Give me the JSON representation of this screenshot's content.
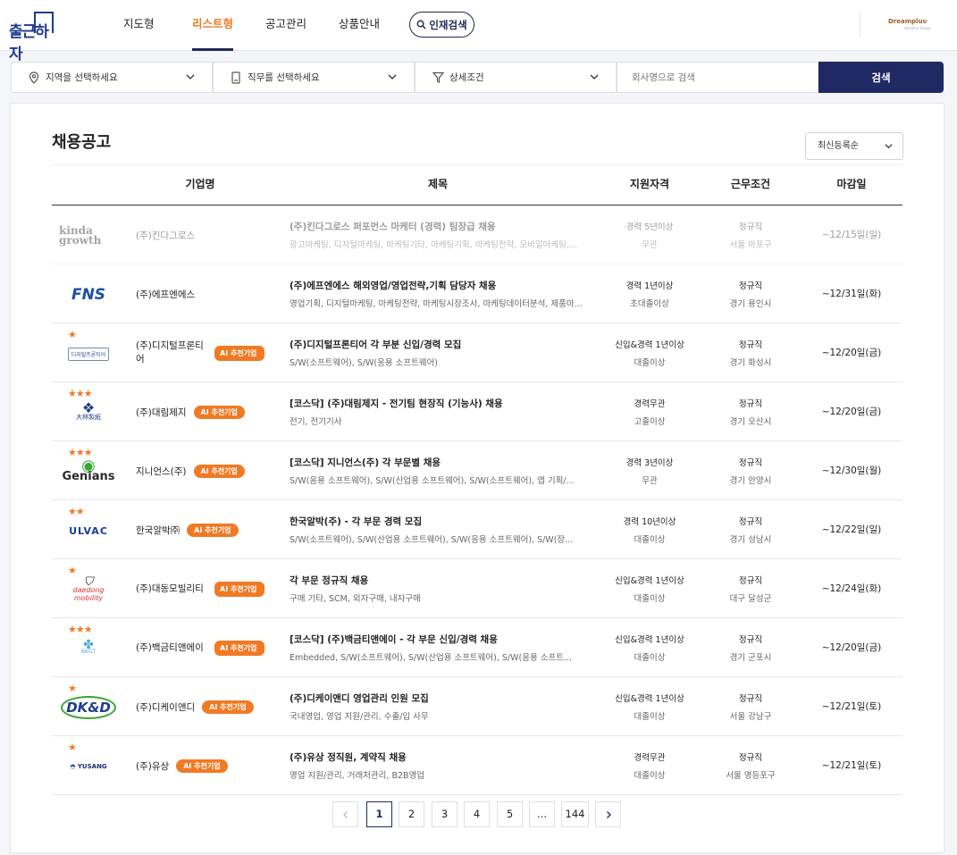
{
  "header": {
    "logo_text": "출근하자",
    "nav": [
      "지도형",
      "리스트형",
      "공고관리",
      "상품안내"
    ],
    "active_nav": "리스트형",
    "talent_search_label": "인재검색",
    "brand_text": "Dreamplus",
    "brand_sub": "Hanwha Group"
  },
  "search": {
    "region_placeholder": "지역을 선택하세요",
    "job_placeholder": "직무를 선택하세요",
    "detail_label": "상세조건",
    "company_placeholder": "회사명으로 검색",
    "search_button": "검색"
  },
  "main": {
    "title": "채용공고",
    "sort_selected": "최신등록순",
    "columns": [
      "기업명",
      "제목",
      "지원자격",
      "근무조건",
      "마감일"
    ],
    "ai_badge": "AI 추천기업"
  },
  "rows": [
    {
      "logo": "kinda growth",
      "stars": "",
      "company": "(주)킨다그로스",
      "ai": false,
      "dimmed": true,
      "title": "(주)킨다그로스 퍼포먼스 마케터 (경력) 팀장급 채용",
      "tags": "광고마케팅, 디지털마케팅, 마케팅기타, 마케팅기획, 마케팅전략, 모바일마케팅,...",
      "qual1": "경력 5년이상",
      "qual2": "무관",
      "work1": "정규직",
      "work2": "서울 마포구",
      "deadline": "~12/15일(일)"
    },
    {
      "logo": "FNS",
      "stars": "",
      "company": "(주)에프엔에스",
      "ai": false,
      "dimmed": false,
      "title": "(주)에프엔에스 해외영업/영업전략,기획 담당자 채용",
      "tags": "영업기획, 디지털마케팅, 마케팅전략, 마케팅시장조사, 마케팅데이터분석, 제품마...",
      "qual1": "경력 1년이상",
      "qual2": "초대졸이상",
      "work1": "정규직",
      "work2": "경기 용인시",
      "deadline": "~12/31일(화)"
    },
    {
      "logo": "디지털프론티어",
      "stars": "★",
      "company": "(주)디지털프론티어",
      "ai": true,
      "dimmed": false,
      "title": "(주)디지털프론티어 각 부분 신입/경력 모집",
      "tags": "S/W(소프트웨어), S/W(응용 소프트웨어)",
      "qual1": "신입&경력 1년이상",
      "qual2": "대졸이상",
      "work1": "정규직",
      "work2": "경기 화성시",
      "deadline": "~12/20일(금)"
    },
    {
      "logo": "大林製紙",
      "stars": "★★★",
      "company": "(주)대림제지",
      "ai": true,
      "dimmed": false,
      "title": "[코스닥] (주)대림제지 - 전기팀 현장직 (기능사) 채용",
      "tags": "전기, 전기기사",
      "qual1": "경력무관",
      "qual2": "고졸이상",
      "work1": "정규직",
      "work2": "경기 오산시",
      "deadline": "~12/20일(금)"
    },
    {
      "logo": "Genians",
      "stars": "★★★",
      "company": "지니언스(주)",
      "ai": true,
      "dimmed": false,
      "title": "[코스닥] 지니언스(주) 각 부문별 채용",
      "tags": "S/W(응용 소프트웨어), S/W(산업용 소프트웨어), S/W(소프트웨어), 앱 기획/...",
      "qual1": "경력 3년이상",
      "qual2": "무관",
      "work1": "정규직",
      "work2": "경기 안양시",
      "deadline": "~12/30일(월)"
    },
    {
      "logo": "ULVAC",
      "stars": "★★",
      "company": "한국알박㈜",
      "ai": true,
      "dimmed": false,
      "title": "한국알박(주) - 각 부문 경력 모집",
      "tags": "S/W(소프트웨어), S/W(산업용 소프트웨어), S/W(응용 소프트웨어), S/W(장...",
      "qual1": "경력 10년이상",
      "qual2": "대졸이상",
      "work1": "정규직",
      "work2": "경기 성남시",
      "deadline": "~12/22일(일)"
    },
    {
      "logo": "daedong mobility",
      "stars": "★",
      "company": "(주)대동모빌리티",
      "ai": true,
      "dimmed": false,
      "title": "각 부문 정규직 채용",
      "tags": "구매 기타, SCM, 외자구매, 내자구매",
      "qual1": "신입&경력 1년이상",
      "qual2": "대졸이상",
      "work1": "정규직",
      "work2": "대구 달성군",
      "deadline": "~12/24일(화)"
    },
    {
      "logo": "BKGT",
      "stars": "★★★",
      "company": "(주)백금티앤에이",
      "ai": true,
      "dimmed": false,
      "title": "[코스닥] (주)백금티앤에이 - 각 부문 신입/경력 채용",
      "tags": "Embedded, S/W(소프트웨어), S/W(산업용 소프트웨어), S/W(응용 소프트...",
      "qual1": "신입&경력 1년이상",
      "qual2": "대졸이상",
      "work1": "정규직",
      "work2": "경기 군포시",
      "deadline": "~12/20일(금)"
    },
    {
      "logo": "DK&D",
      "stars": "★",
      "company": "(주)디케이앤디",
      "ai": true,
      "dimmed": false,
      "title": "(주)디케이앤디 영업관리 인원 모집",
      "tags": "국내영업, 영업 지원/관리, 수출/입 사무",
      "qual1": "신입&경력 1년이상",
      "qual2": "대졸이상",
      "work1": "정규직",
      "work2": "서울 강남구",
      "deadline": "~12/21일(토)"
    },
    {
      "logo": "YUSANG",
      "stars": "★",
      "company": "(주)유상",
      "ai": true,
      "dimmed": false,
      "title": "(주)유상 정직원, 계약직 채용",
      "tags": "영업 지원/관리, 거래처관리, B2B영업",
      "qual1": "경력무관",
      "qual2": "대졸이상",
      "work1": "정규직",
      "work2": "서울 영등포구",
      "deadline": "~12/21일(토)"
    }
  ],
  "pagination": {
    "pages": [
      "1",
      "2",
      "3",
      "4",
      "5",
      "...",
      "144"
    ],
    "current": "1"
  },
  "colors": {
    "accent": "#f07a24",
    "primary": "#1f2a64"
  }
}
